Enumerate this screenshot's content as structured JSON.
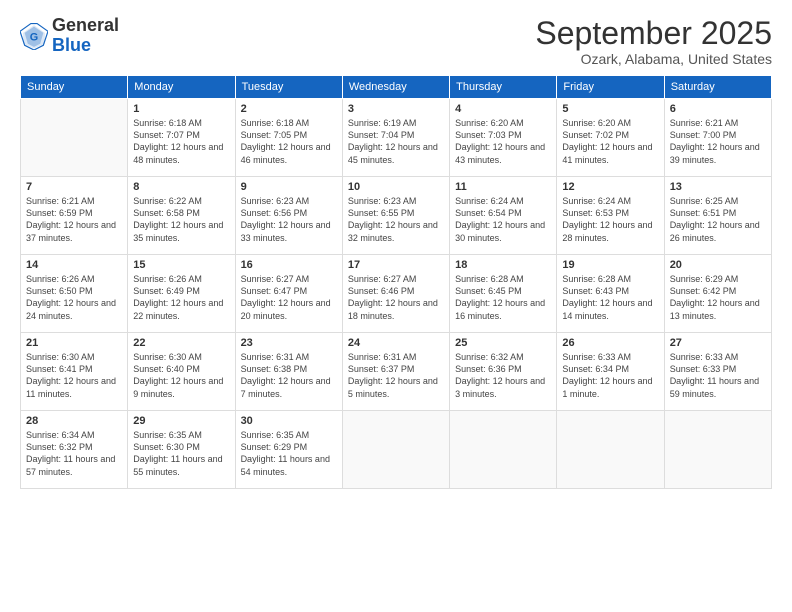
{
  "header": {
    "logo_line1": "General",
    "logo_line2": "Blue",
    "month_title": "September 2025",
    "location": "Ozark, Alabama, United States"
  },
  "days_of_week": [
    "Sunday",
    "Monday",
    "Tuesday",
    "Wednesday",
    "Thursday",
    "Friday",
    "Saturday"
  ],
  "weeks": [
    [
      {
        "day": "",
        "sunrise": "",
        "sunset": "",
        "daylight": ""
      },
      {
        "day": "1",
        "sunrise": "Sunrise: 6:18 AM",
        "sunset": "Sunset: 7:07 PM",
        "daylight": "Daylight: 12 hours and 48 minutes."
      },
      {
        "day": "2",
        "sunrise": "Sunrise: 6:18 AM",
        "sunset": "Sunset: 7:05 PM",
        "daylight": "Daylight: 12 hours and 46 minutes."
      },
      {
        "day": "3",
        "sunrise": "Sunrise: 6:19 AM",
        "sunset": "Sunset: 7:04 PM",
        "daylight": "Daylight: 12 hours and 45 minutes."
      },
      {
        "day": "4",
        "sunrise": "Sunrise: 6:20 AM",
        "sunset": "Sunset: 7:03 PM",
        "daylight": "Daylight: 12 hours and 43 minutes."
      },
      {
        "day": "5",
        "sunrise": "Sunrise: 6:20 AM",
        "sunset": "Sunset: 7:02 PM",
        "daylight": "Daylight: 12 hours and 41 minutes."
      },
      {
        "day": "6",
        "sunrise": "Sunrise: 6:21 AM",
        "sunset": "Sunset: 7:00 PM",
        "daylight": "Daylight: 12 hours and 39 minutes."
      }
    ],
    [
      {
        "day": "7",
        "sunrise": "Sunrise: 6:21 AM",
        "sunset": "Sunset: 6:59 PM",
        "daylight": "Daylight: 12 hours and 37 minutes."
      },
      {
        "day": "8",
        "sunrise": "Sunrise: 6:22 AM",
        "sunset": "Sunset: 6:58 PM",
        "daylight": "Daylight: 12 hours and 35 minutes."
      },
      {
        "day": "9",
        "sunrise": "Sunrise: 6:23 AM",
        "sunset": "Sunset: 6:56 PM",
        "daylight": "Daylight: 12 hours and 33 minutes."
      },
      {
        "day": "10",
        "sunrise": "Sunrise: 6:23 AM",
        "sunset": "Sunset: 6:55 PM",
        "daylight": "Daylight: 12 hours and 32 minutes."
      },
      {
        "day": "11",
        "sunrise": "Sunrise: 6:24 AM",
        "sunset": "Sunset: 6:54 PM",
        "daylight": "Daylight: 12 hours and 30 minutes."
      },
      {
        "day": "12",
        "sunrise": "Sunrise: 6:24 AM",
        "sunset": "Sunset: 6:53 PM",
        "daylight": "Daylight: 12 hours and 28 minutes."
      },
      {
        "day": "13",
        "sunrise": "Sunrise: 6:25 AM",
        "sunset": "Sunset: 6:51 PM",
        "daylight": "Daylight: 12 hours and 26 minutes."
      }
    ],
    [
      {
        "day": "14",
        "sunrise": "Sunrise: 6:26 AM",
        "sunset": "Sunset: 6:50 PM",
        "daylight": "Daylight: 12 hours and 24 minutes."
      },
      {
        "day": "15",
        "sunrise": "Sunrise: 6:26 AM",
        "sunset": "Sunset: 6:49 PM",
        "daylight": "Daylight: 12 hours and 22 minutes."
      },
      {
        "day": "16",
        "sunrise": "Sunrise: 6:27 AM",
        "sunset": "Sunset: 6:47 PM",
        "daylight": "Daylight: 12 hours and 20 minutes."
      },
      {
        "day": "17",
        "sunrise": "Sunrise: 6:27 AM",
        "sunset": "Sunset: 6:46 PM",
        "daylight": "Daylight: 12 hours and 18 minutes."
      },
      {
        "day": "18",
        "sunrise": "Sunrise: 6:28 AM",
        "sunset": "Sunset: 6:45 PM",
        "daylight": "Daylight: 12 hours and 16 minutes."
      },
      {
        "day": "19",
        "sunrise": "Sunrise: 6:28 AM",
        "sunset": "Sunset: 6:43 PM",
        "daylight": "Daylight: 12 hours and 14 minutes."
      },
      {
        "day": "20",
        "sunrise": "Sunrise: 6:29 AM",
        "sunset": "Sunset: 6:42 PM",
        "daylight": "Daylight: 12 hours and 13 minutes."
      }
    ],
    [
      {
        "day": "21",
        "sunrise": "Sunrise: 6:30 AM",
        "sunset": "Sunset: 6:41 PM",
        "daylight": "Daylight: 12 hours and 11 minutes."
      },
      {
        "day": "22",
        "sunrise": "Sunrise: 6:30 AM",
        "sunset": "Sunset: 6:40 PM",
        "daylight": "Daylight: 12 hours and 9 minutes."
      },
      {
        "day": "23",
        "sunrise": "Sunrise: 6:31 AM",
        "sunset": "Sunset: 6:38 PM",
        "daylight": "Daylight: 12 hours and 7 minutes."
      },
      {
        "day": "24",
        "sunrise": "Sunrise: 6:31 AM",
        "sunset": "Sunset: 6:37 PM",
        "daylight": "Daylight: 12 hours and 5 minutes."
      },
      {
        "day": "25",
        "sunrise": "Sunrise: 6:32 AM",
        "sunset": "Sunset: 6:36 PM",
        "daylight": "Daylight: 12 hours and 3 minutes."
      },
      {
        "day": "26",
        "sunrise": "Sunrise: 6:33 AM",
        "sunset": "Sunset: 6:34 PM",
        "daylight": "Daylight: 12 hours and 1 minute."
      },
      {
        "day": "27",
        "sunrise": "Sunrise: 6:33 AM",
        "sunset": "Sunset: 6:33 PM",
        "daylight": "Daylight: 11 hours and 59 minutes."
      }
    ],
    [
      {
        "day": "28",
        "sunrise": "Sunrise: 6:34 AM",
        "sunset": "Sunset: 6:32 PM",
        "daylight": "Daylight: 11 hours and 57 minutes."
      },
      {
        "day": "29",
        "sunrise": "Sunrise: 6:35 AM",
        "sunset": "Sunset: 6:30 PM",
        "daylight": "Daylight: 11 hours and 55 minutes."
      },
      {
        "day": "30",
        "sunrise": "Sunrise: 6:35 AM",
        "sunset": "Sunset: 6:29 PM",
        "daylight": "Daylight: 11 hours and 54 minutes."
      },
      {
        "day": "",
        "sunrise": "",
        "sunset": "",
        "daylight": ""
      },
      {
        "day": "",
        "sunrise": "",
        "sunset": "",
        "daylight": ""
      },
      {
        "day": "",
        "sunrise": "",
        "sunset": "",
        "daylight": ""
      },
      {
        "day": "",
        "sunrise": "",
        "sunset": "",
        "daylight": ""
      }
    ]
  ]
}
